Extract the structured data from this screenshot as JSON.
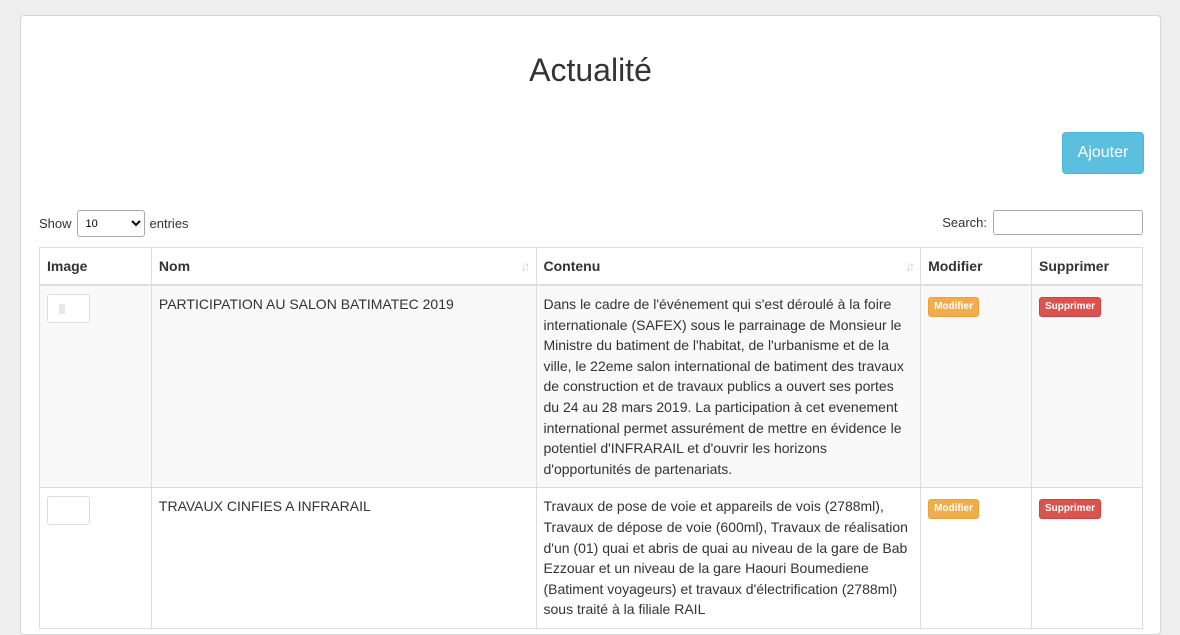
{
  "page": {
    "title": "Actualité",
    "add_button_label": "Ajouter"
  },
  "table_controls": {
    "show_label": "Show",
    "length_value": "10",
    "length_options": [
      "10"
    ],
    "entries_label": "entries",
    "search_label": "Search:",
    "search_value": ""
  },
  "table": {
    "columns": [
      "Image",
      "Nom",
      "Contenu",
      "Modifier",
      "Supprimer"
    ],
    "rows": [
      {
        "image_icon": "thumbnail-photo",
        "nom": "PARTICIPATION AU SALON BATIMATEC 2019",
        "contenu": "Dans le cadre de l'événement qui s'est déroulé à la foire internationale (SAFEX) sous le parrainage de Monsieur le Ministre du batiment de l'habitat, de l'urbanisme et de la ville, le 22eme salon international de batiment des travaux de construction et de travaux publics a ouvert ses portes du 24 au 28 mars 2019. La participation à cet evenement international permet assurément de mettre en évidence le potentiel d'INFRARAIL et d'ouvrir les horizons d'opportunités de partenariats.",
        "modifier_label": "Modifier",
        "supprimer_label": "Supprimer"
      },
      {
        "image_icon": "thumbnail-photo",
        "nom": "TRAVAUX CINFIES A INFRARAIL",
        "contenu": "Travaux de pose de voie et appareils de vois (2788ml), Travaux de dépose de voie (600ml), Travaux de réalisation d'un (01) quai et abris de quai au niveau de la gare de Bab Ezzouar et un niveau de la gare Haouri Boumediene (Batiment voyageurs) et travaux d'électrification (2788ml) sous traité à la filiale RAIL",
        "modifier_label": "Modifier",
        "supprimer_label": "Supprimer"
      }
    ]
  },
  "colors": {
    "add_button": "#5bc0de",
    "modifier_badge": "#f0ad4e",
    "supprimer_badge": "#d9534f"
  }
}
